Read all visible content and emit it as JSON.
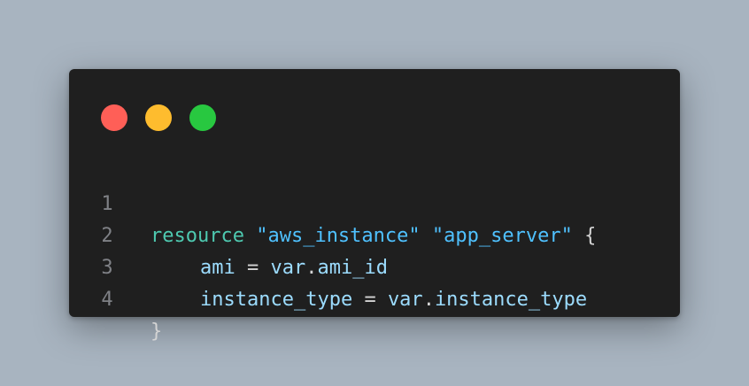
{
  "window": {
    "traffic_lights": [
      {
        "name": "close",
        "color": "#ff5f57"
      },
      {
        "name": "minimize",
        "color": "#febc2e"
      },
      {
        "name": "maximize",
        "color": "#28c840"
      }
    ]
  },
  "colors": {
    "background": "#a8b4c0",
    "editor_bg": "#1f1f1f",
    "keyword": "#4ec9b0",
    "string": "#4fc1ff",
    "identifier": "#9cdcfe",
    "punctuation": "#d4d4d4",
    "line_number": "#7f8186"
  },
  "code": {
    "lines": [
      {
        "number": "1",
        "keyword": "resource",
        "string1": "\"aws_instance\"",
        "string2": "\"app_server\"",
        "brace": "{"
      },
      {
        "number": "2",
        "name": "ami",
        "op": "=",
        "value_prefix": "var",
        "dot": ".",
        "value_field": "ami_id"
      },
      {
        "number": "3",
        "name": "instance_type",
        "op": "=",
        "value_prefix": "var",
        "dot": ".",
        "value_field": "instance_type"
      },
      {
        "number": "4",
        "brace": "}"
      }
    ]
  }
}
